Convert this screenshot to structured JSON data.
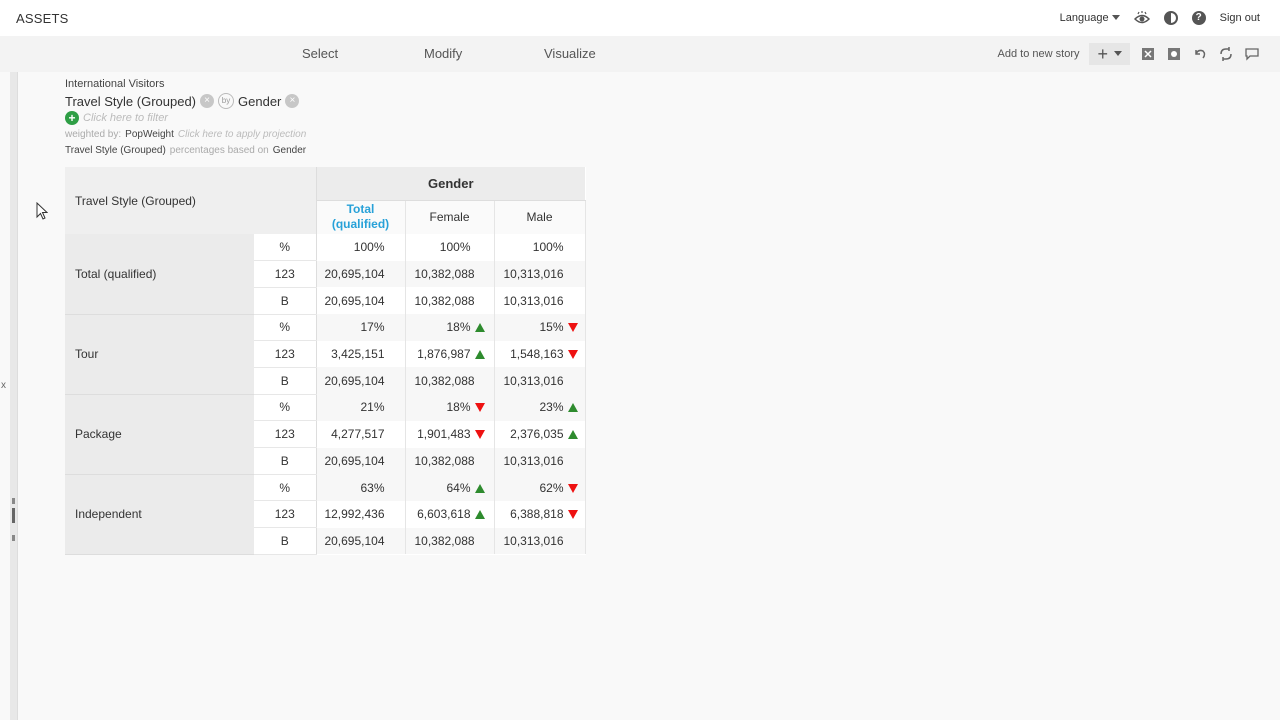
{
  "app": {
    "title": "ASSETS"
  },
  "topbar": {
    "language": "Language",
    "signout": "Sign out"
  },
  "nav": {
    "select": "Select",
    "modify": "Modify",
    "visualize": "Visualize",
    "add_to_story": "Add to new story",
    "plus": "+"
  },
  "meta": {
    "dataset": "International Visitors",
    "row_var": "Travel Style (Grouped)",
    "col_var": "Gender",
    "filter_hint": "Click here to filter",
    "weighted_label": "weighted by:",
    "weight": "PopWeight",
    "projection_hint": "Click here to apply projection",
    "basis_prefix": "Travel Style (Grouped)",
    "basis_middle": "percentages based on",
    "basis_suffix": "Gender"
  },
  "table": {
    "row_header": "Travel Style (Grouped)",
    "group_header": "Gender",
    "columns": [
      "Total (qualified)",
      "Female",
      "Male"
    ],
    "rows": [
      {
        "label": "Total (qualified)",
        "stats": [
          {
            "stat": "%",
            "values": [
              "100%",
              "100%",
              "100%"
            ],
            "arrows": [
              "none",
              "none",
              "none"
            ]
          },
          {
            "stat": "123",
            "values": [
              "20,695,104",
              "10,382,088",
              "10,313,016"
            ],
            "arrows": [
              "none",
              "none",
              "none"
            ]
          },
          {
            "stat": "B",
            "values": [
              "20,695,104",
              "10,382,088",
              "10,313,016"
            ],
            "arrows": [
              "none",
              "none",
              "none"
            ]
          }
        ]
      },
      {
        "label": "Tour",
        "stats": [
          {
            "stat": "%",
            "values": [
              "17%",
              "18%",
              "15%"
            ],
            "arrows": [
              "none",
              "up",
              "down"
            ]
          },
          {
            "stat": "123",
            "values": [
              "3,425,151",
              "1,876,987",
              "1,548,163"
            ],
            "arrows": [
              "none",
              "up",
              "down"
            ]
          },
          {
            "stat": "B",
            "values": [
              "20,695,104",
              "10,382,088",
              "10,313,016"
            ],
            "arrows": [
              "none",
              "none",
              "none"
            ]
          }
        ]
      },
      {
        "label": "Package",
        "stats": [
          {
            "stat": "%",
            "values": [
              "21%",
              "18%",
              "23%"
            ],
            "arrows": [
              "none",
              "down",
              "up"
            ]
          },
          {
            "stat": "123",
            "values": [
              "4,277,517",
              "1,901,483",
              "2,376,035"
            ],
            "arrows": [
              "none",
              "down",
              "up"
            ]
          },
          {
            "stat": "B",
            "values": [
              "20,695,104",
              "10,382,088",
              "10,313,016"
            ],
            "arrows": [
              "none",
              "none",
              "none"
            ]
          }
        ]
      },
      {
        "label": "Independent",
        "stats": [
          {
            "stat": "%",
            "values": [
              "63%",
              "64%",
              "62%"
            ],
            "arrows": [
              "none",
              "up",
              "down"
            ]
          },
          {
            "stat": "123",
            "values": [
              "12,992,436",
              "6,603,618",
              "6,388,818"
            ],
            "arrows": [
              "none",
              "up",
              "down"
            ]
          },
          {
            "stat": "B",
            "values": [
              "20,695,104",
              "10,382,088",
              "10,313,016"
            ],
            "arrows": [
              "none",
              "none",
              "none"
            ]
          }
        ]
      }
    ]
  },
  "colors": {
    "accent": "#27a1d8",
    "up": "#2e8b2e",
    "down": "#e11111",
    "filter_add": "#2e9e45"
  },
  "misc": {
    "left_x": "x"
  }
}
